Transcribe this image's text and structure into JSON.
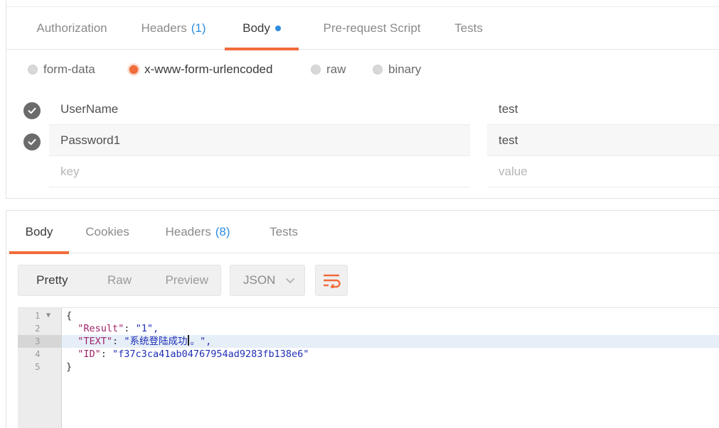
{
  "request": {
    "tabs": [
      {
        "label": "Authorization",
        "count": ""
      },
      {
        "label": "Headers",
        "count": "(1)"
      },
      {
        "label": "Body",
        "count": "",
        "dot": true,
        "active": true
      },
      {
        "label": "Pre-request Script",
        "count": ""
      },
      {
        "label": "Tests",
        "count": ""
      }
    ],
    "body_types": [
      {
        "label": "form-data",
        "checked": false
      },
      {
        "label": "x-www-form-urlencoded",
        "checked": true
      },
      {
        "label": "raw",
        "checked": false
      },
      {
        "label": "binary",
        "checked": false
      }
    ],
    "params": [
      {
        "key": "UserName",
        "value": "test",
        "enabled": true
      },
      {
        "key": "Password1",
        "value": "test",
        "enabled": true
      }
    ],
    "new_param": {
      "key_placeholder": "key",
      "value_placeholder": "value"
    }
  },
  "response": {
    "tabs": [
      {
        "label": "Body",
        "count": "",
        "active": true
      },
      {
        "label": "Cookies",
        "count": ""
      },
      {
        "label": "Headers",
        "count": "(8)"
      },
      {
        "label": "Tests",
        "count": ""
      }
    ],
    "view_modes": [
      "Pretty",
      "Raw",
      "Preview"
    ],
    "active_view": "Pretty",
    "format": "JSON",
    "wrap_icon": "wrap-lines-icon",
    "code": {
      "line_numbers": [
        "1",
        "2",
        "3",
        "4",
        "5"
      ],
      "highlighted_line": 3,
      "lines": [
        {
          "open": "{"
        },
        {
          "key": "\"Result\"",
          "value": "\"1\","
        },
        {
          "key": "\"TEXT\"",
          "value_before_cursor": "\"系统登陆成功",
          "value_after_cursor": "。\","
        },
        {
          "key": "\"ID\"",
          "value": "\"f37c3ca41ab04767954ad9283fb138e6\""
        },
        {
          "close": "}"
        }
      ]
    }
  },
  "colors": {
    "accent": "#f26b3a",
    "badge": "#2f8ce0",
    "json_key": "#a0246a",
    "json_string": "#1f2fb5"
  }
}
